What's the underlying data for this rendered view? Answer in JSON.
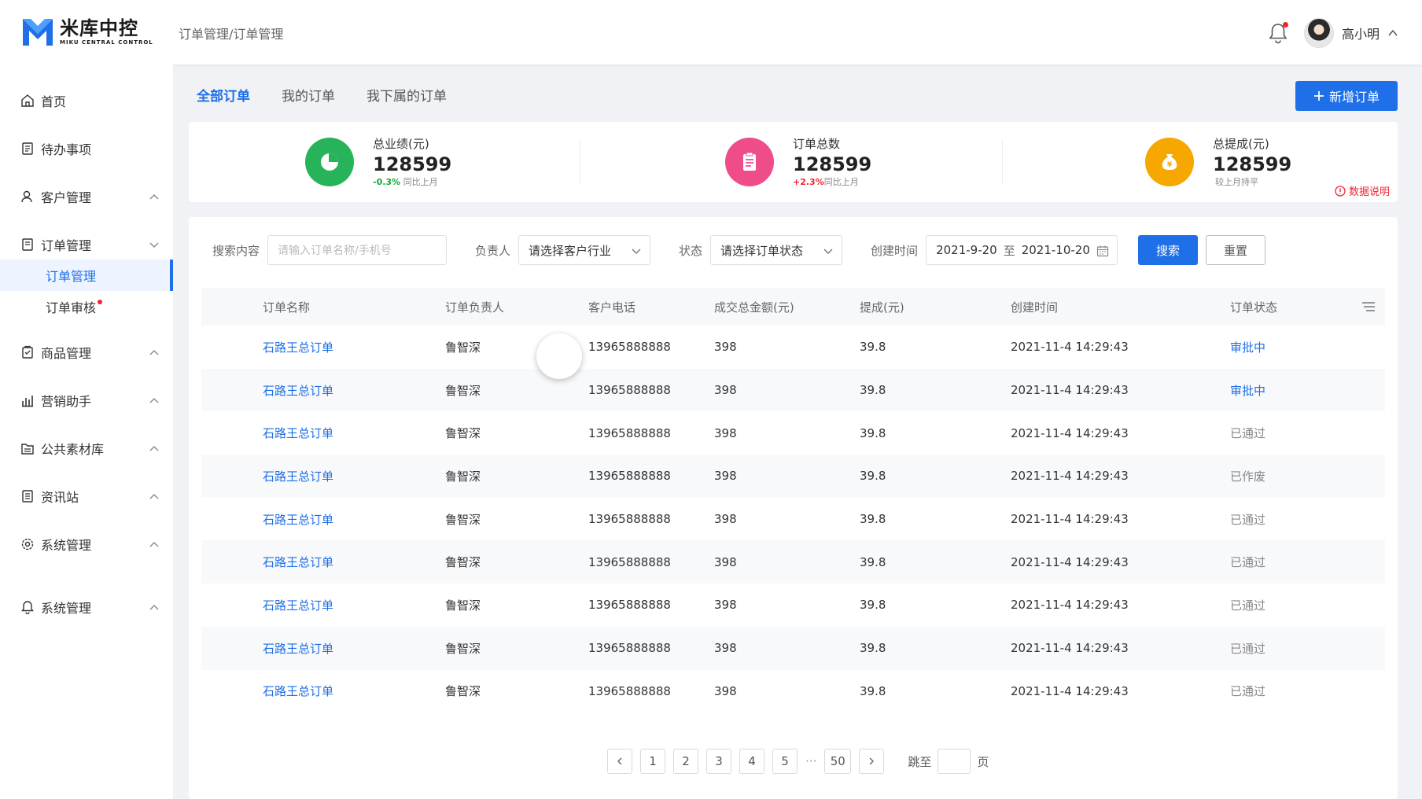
{
  "logo": {
    "cn": "米库中控",
    "en": "MIKU CENTRAL CONTROL"
  },
  "breadcrumb": "订单管理/订单管理",
  "user": {
    "name": "高小明"
  },
  "sidebar": {
    "items": [
      {
        "label": "首页"
      },
      {
        "label": "待办事项"
      },
      {
        "label": "客户管理"
      },
      {
        "label": "订单管理"
      },
      {
        "label": "商品管理"
      },
      {
        "label": "营销助手"
      },
      {
        "label": "公共素材库"
      },
      {
        "label": "资讯站"
      },
      {
        "label": "系统管理"
      },
      {
        "label": "系统管理"
      }
    ],
    "sub_items": [
      {
        "label": "订单管理"
      },
      {
        "label": "订单审核"
      }
    ]
  },
  "tabs": [
    "全部订单",
    "我的订单",
    "我下属的订单"
  ],
  "new_order_button": "新增订单",
  "stats": [
    {
      "label": "总业绩(元)",
      "value": "128599",
      "delta": "-0.3%",
      "delta_note": "同比上月",
      "color": "#27b35a"
    },
    {
      "label": "订单总数",
      "value": "128599",
      "delta": "+2.3%",
      "delta_note": "同比上月",
      "color": "#ee4d8a"
    },
    {
      "label": "总提成(元)",
      "value": "128599",
      "delta": "",
      "delta_note": "较上月持平",
      "color": "#f6a800"
    }
  ],
  "data_note": "数据说明",
  "filters": {
    "search_label": "搜索内容",
    "search_placeholder": "请输入订单名称/手机号",
    "owner_label": "负责人",
    "owner_value": "请选择客户行业",
    "status_label": "状态",
    "status_value": "请选择订单状态",
    "date_label": "创建时间",
    "date_start": "2021-9-20",
    "date_sep": "至",
    "date_end": "2021-10-20",
    "search_button": "搜索",
    "reset_button": "重置"
  },
  "table": {
    "headers": [
      "订单名称",
      "订单负责人",
      "客户电话",
      "成交总金额(元)",
      "提成(元)",
      "创建时间",
      "订单状态"
    ],
    "rows": [
      {
        "name": "石路王总订单",
        "owner": "鲁智深",
        "phone": "13965888888",
        "amount": "398",
        "commission": "39.8",
        "created": "2021-11-4 14:29:43",
        "status": "审批中"
      },
      {
        "name": "石路王总订单",
        "owner": "鲁智深",
        "phone": "13965888888",
        "amount": "398",
        "commission": "39.8",
        "created": "2021-11-4 14:29:43",
        "status": "审批中"
      },
      {
        "name": "石路王总订单",
        "owner": "鲁智深",
        "phone": "13965888888",
        "amount": "398",
        "commission": "39.8",
        "created": "2021-11-4 14:29:43",
        "status": "已通过"
      },
      {
        "name": "石路王总订单",
        "owner": "鲁智深",
        "phone": "13965888888",
        "amount": "398",
        "commission": "39.8",
        "created": "2021-11-4 14:29:43",
        "status": "已作废"
      },
      {
        "name": "石路王总订单",
        "owner": "鲁智深",
        "phone": "13965888888",
        "amount": "398",
        "commission": "39.8",
        "created": "2021-11-4 14:29:43",
        "status": "已通过"
      },
      {
        "name": "石路王总订单",
        "owner": "鲁智深",
        "phone": "13965888888",
        "amount": "398",
        "commission": "39.8",
        "created": "2021-11-4 14:29:43",
        "status": "已通过"
      },
      {
        "name": "石路王总订单",
        "owner": "鲁智深",
        "phone": "13965888888",
        "amount": "398",
        "commission": "39.8",
        "created": "2021-11-4 14:29:43",
        "status": "已通过"
      },
      {
        "name": "石路王总订单",
        "owner": "鲁智深",
        "phone": "13965888888",
        "amount": "398",
        "commission": "39.8",
        "created": "2021-11-4 14:29:43",
        "status": "已通过"
      },
      {
        "name": "石路王总订单",
        "owner": "鲁智深",
        "phone": "13965888888",
        "amount": "398",
        "commission": "39.8",
        "created": "2021-11-4 14:29:43",
        "status": "已通过"
      }
    ]
  },
  "pagination": {
    "pages": [
      "1",
      "2",
      "3",
      "4",
      "5"
    ],
    "ellipsis": "···",
    "last": "50",
    "jump_label": "跳至",
    "page_unit": "页"
  },
  "colors": {
    "primary": "#1e6fe8",
    "danger": "#f5222d"
  }
}
